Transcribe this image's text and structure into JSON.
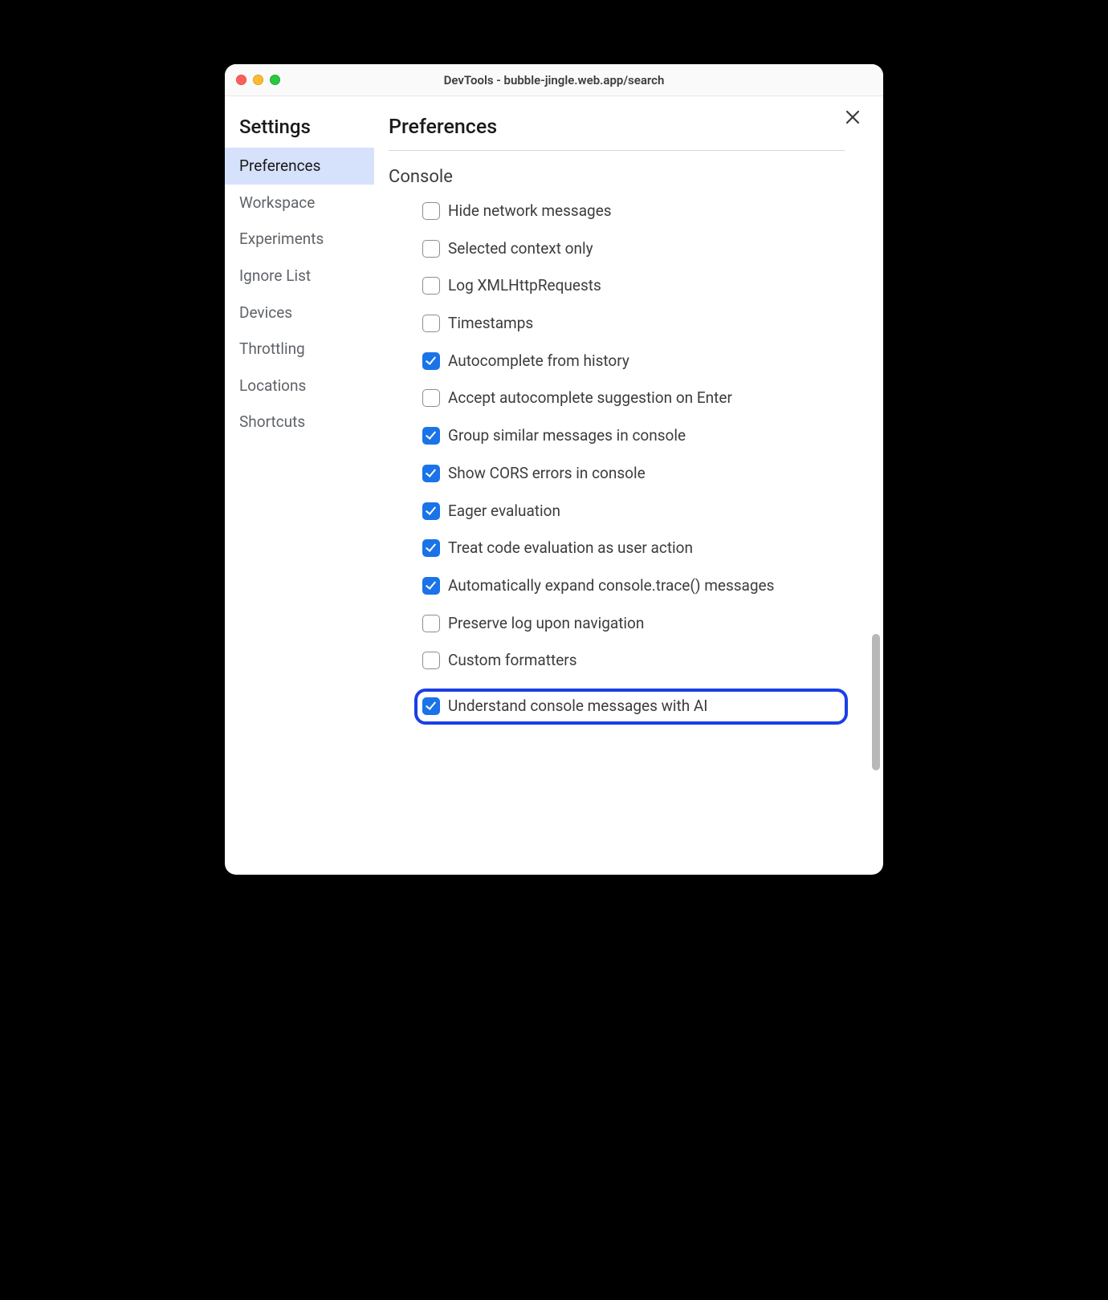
{
  "window_title": "DevTools - bubble-jingle.web.app/search",
  "sidebar": {
    "title": "Settings",
    "items": [
      {
        "label": "Preferences",
        "active": true
      },
      {
        "label": "Workspace",
        "active": false
      },
      {
        "label": "Experiments",
        "active": false
      },
      {
        "label": "Ignore List",
        "active": false
      },
      {
        "label": "Devices",
        "active": false
      },
      {
        "label": "Throttling",
        "active": false
      },
      {
        "label": "Locations",
        "active": false
      },
      {
        "label": "Shortcuts",
        "active": false
      }
    ]
  },
  "main": {
    "title": "Preferences",
    "section": {
      "title": "Console",
      "options": [
        {
          "label": "Hide network messages",
          "checked": false,
          "highlighted": false
        },
        {
          "label": "Selected context only",
          "checked": false,
          "highlighted": false
        },
        {
          "label": "Log XMLHttpRequests",
          "checked": false,
          "highlighted": false
        },
        {
          "label": "Timestamps",
          "checked": false,
          "highlighted": false
        },
        {
          "label": "Autocomplete from history",
          "checked": true,
          "highlighted": false
        },
        {
          "label": "Accept autocomplete suggestion on Enter",
          "checked": false,
          "highlighted": false
        },
        {
          "label": "Group similar messages in console",
          "checked": true,
          "highlighted": false
        },
        {
          "label": "Show CORS errors in console",
          "checked": true,
          "highlighted": false
        },
        {
          "label": "Eager evaluation",
          "checked": true,
          "highlighted": false
        },
        {
          "label": "Treat code evaluation as user action",
          "checked": true,
          "highlighted": false
        },
        {
          "label": "Automatically expand console.trace() messages",
          "checked": true,
          "highlighted": false
        },
        {
          "label": "Preserve log upon navigation",
          "checked": false,
          "highlighted": false
        },
        {
          "label": "Custom formatters",
          "checked": false,
          "highlighted": false
        },
        {
          "label": "Understand console messages with AI",
          "checked": true,
          "highlighted": true
        }
      ]
    }
  }
}
